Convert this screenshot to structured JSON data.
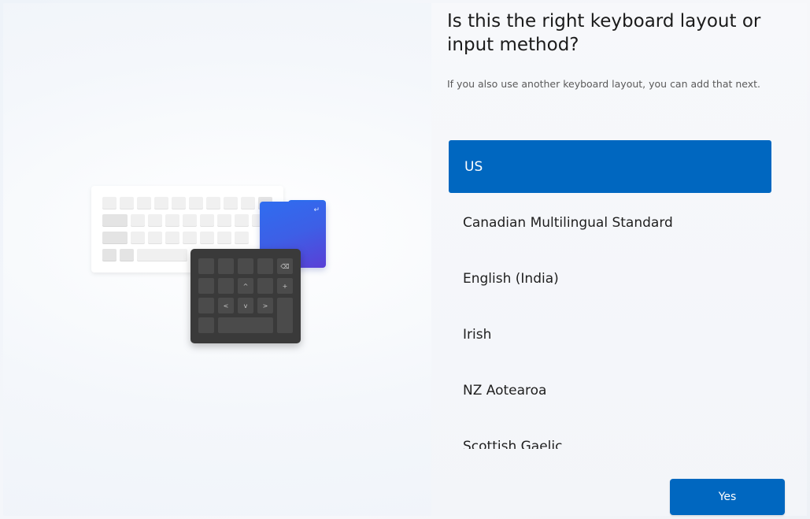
{
  "header": {
    "title": "Is this the right keyboard layout or input method?",
    "subtitle": "If you also use another keyboard layout, you can add that next."
  },
  "layouts": {
    "selected_index": 0,
    "items": [
      {
        "label": "US"
      },
      {
        "label": "Canadian Multilingual Standard"
      },
      {
        "label": "English (India)"
      },
      {
        "label": "Irish"
      },
      {
        "label": "NZ Aotearoa"
      },
      {
        "label": "Scottish Gaelic"
      }
    ]
  },
  "footer": {
    "yes_label": "Yes"
  },
  "colors": {
    "accent": "#0067c0",
    "selected_text": "#ffffff"
  },
  "illustration": {
    "icon": "keyboard-illustration-icon",
    "dark_keys": [
      "⌫",
      "+",
      "^",
      "<",
      "v",
      ">"
    ]
  }
}
